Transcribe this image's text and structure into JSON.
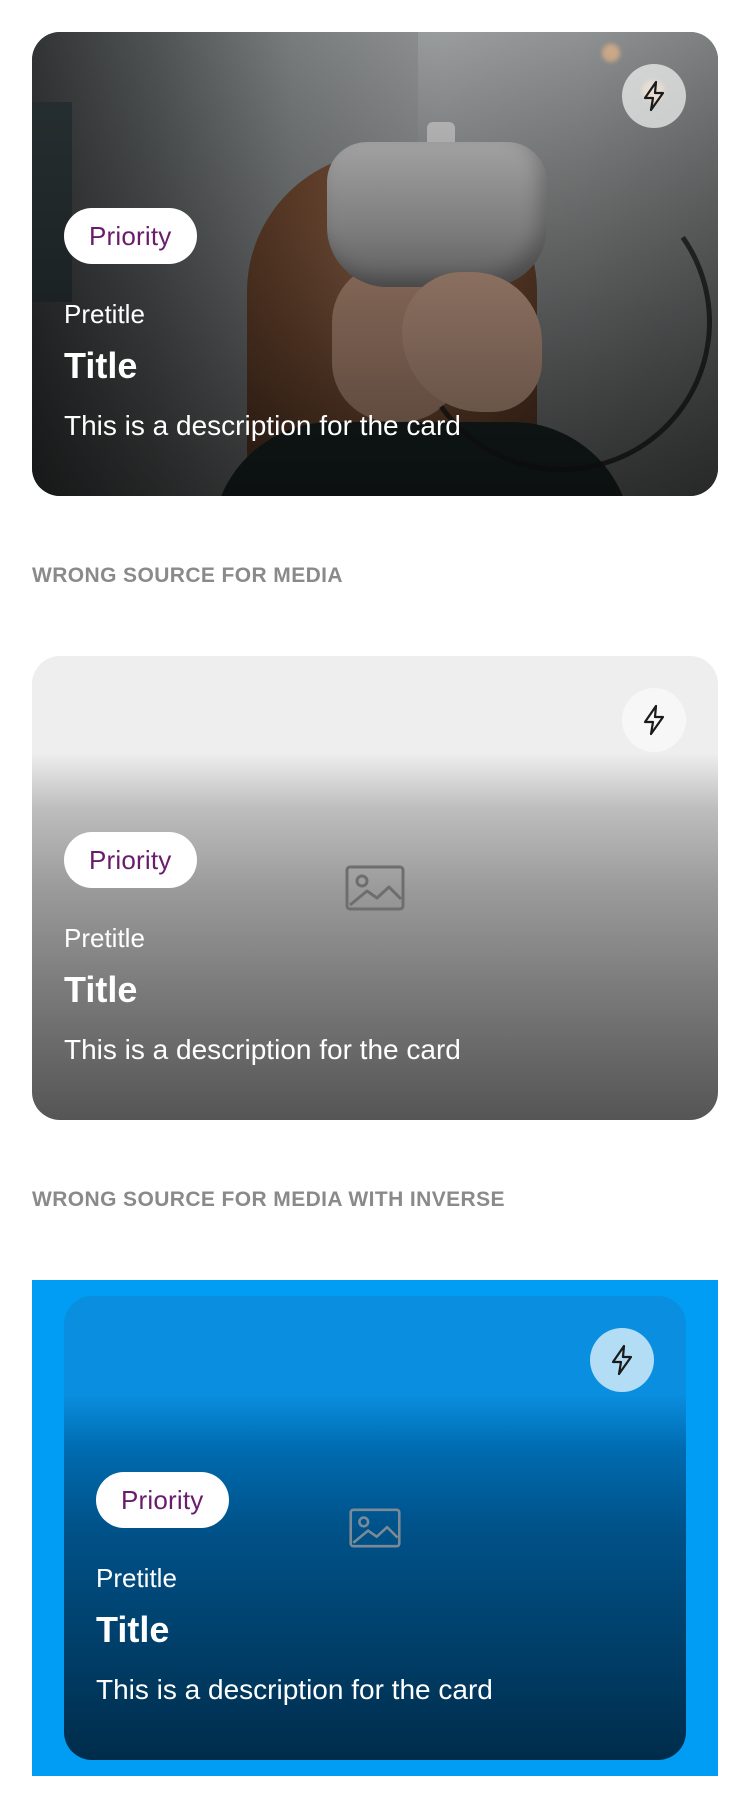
{
  "cards": [
    {
      "badge": "Priority",
      "pretitle": "Pretitle",
      "title": "Title",
      "description": "This is a description for the card",
      "action_icon": "lightning-icon",
      "media": "photo-person-vr-headset"
    },
    {
      "badge": "Priority",
      "pretitle": "Pretitle",
      "title": "Title",
      "description": "This is a description for the card",
      "action_icon": "lightning-icon",
      "media": "image-placeholder-icon"
    },
    {
      "badge": "Priority",
      "pretitle": "Pretitle",
      "title": "Title",
      "description": "This is a description for the card",
      "action_icon": "lightning-icon",
      "media": "image-placeholder-icon"
    }
  ],
  "sections": {
    "wrong_source": "WRONG SOURCE FOR MEDIA",
    "wrong_source_inverse": "WRONG SOURCE FOR MEDIA WITH INVERSE"
  },
  "colors": {
    "badge_text": "#6a1b6c",
    "inverse_background": "#019df4",
    "caption_text": "#8a8a8a"
  }
}
